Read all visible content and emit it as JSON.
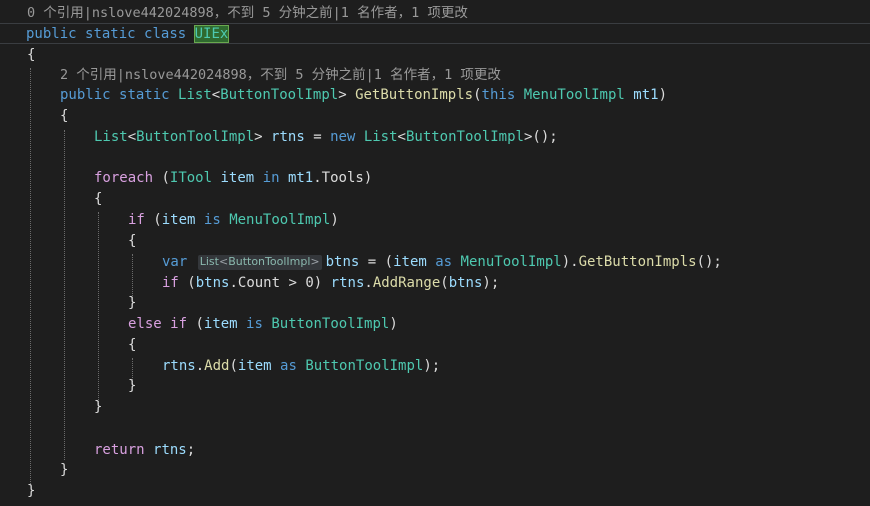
{
  "codelens_class": "0 个引用|nslove442024898，不到 5 分钟之前|1 名作者，1 项更改",
  "codelens_method": "2 个引用|nslove442024898，不到 5 分钟之前|1 名作者，1 项更改",
  "tokens": {
    "public": "public",
    "static": "static",
    "class": "class",
    "class_name": "UIEx",
    "open_brace": "{",
    "close_brace": "}",
    "list_type": "List",
    "lt": "<",
    "gt": ">",
    "button_tool": "ButtonToolImpl",
    "menu_tool": "MenuToolImpl",
    "method_name": "GetButtonImpls",
    "this": "this",
    "param": "mt1",
    "rtns": "rtns",
    "eq": "=",
    "new": "new",
    "call_end": "();",
    "foreach": "foreach",
    "itool": "ITool",
    "item": "item",
    "in": "in",
    "tools": "Tools",
    "if": "if",
    "is": "is",
    "var": "var",
    "btns": "btns",
    "as": "as",
    "count": "Count",
    "addrange": "AddRange",
    "else": "else",
    "add": "Add",
    "return": "return",
    "zero": "0",
    "hint_text_list": "List",
    "hint_text_type": "ButtonToolImpl"
  }
}
